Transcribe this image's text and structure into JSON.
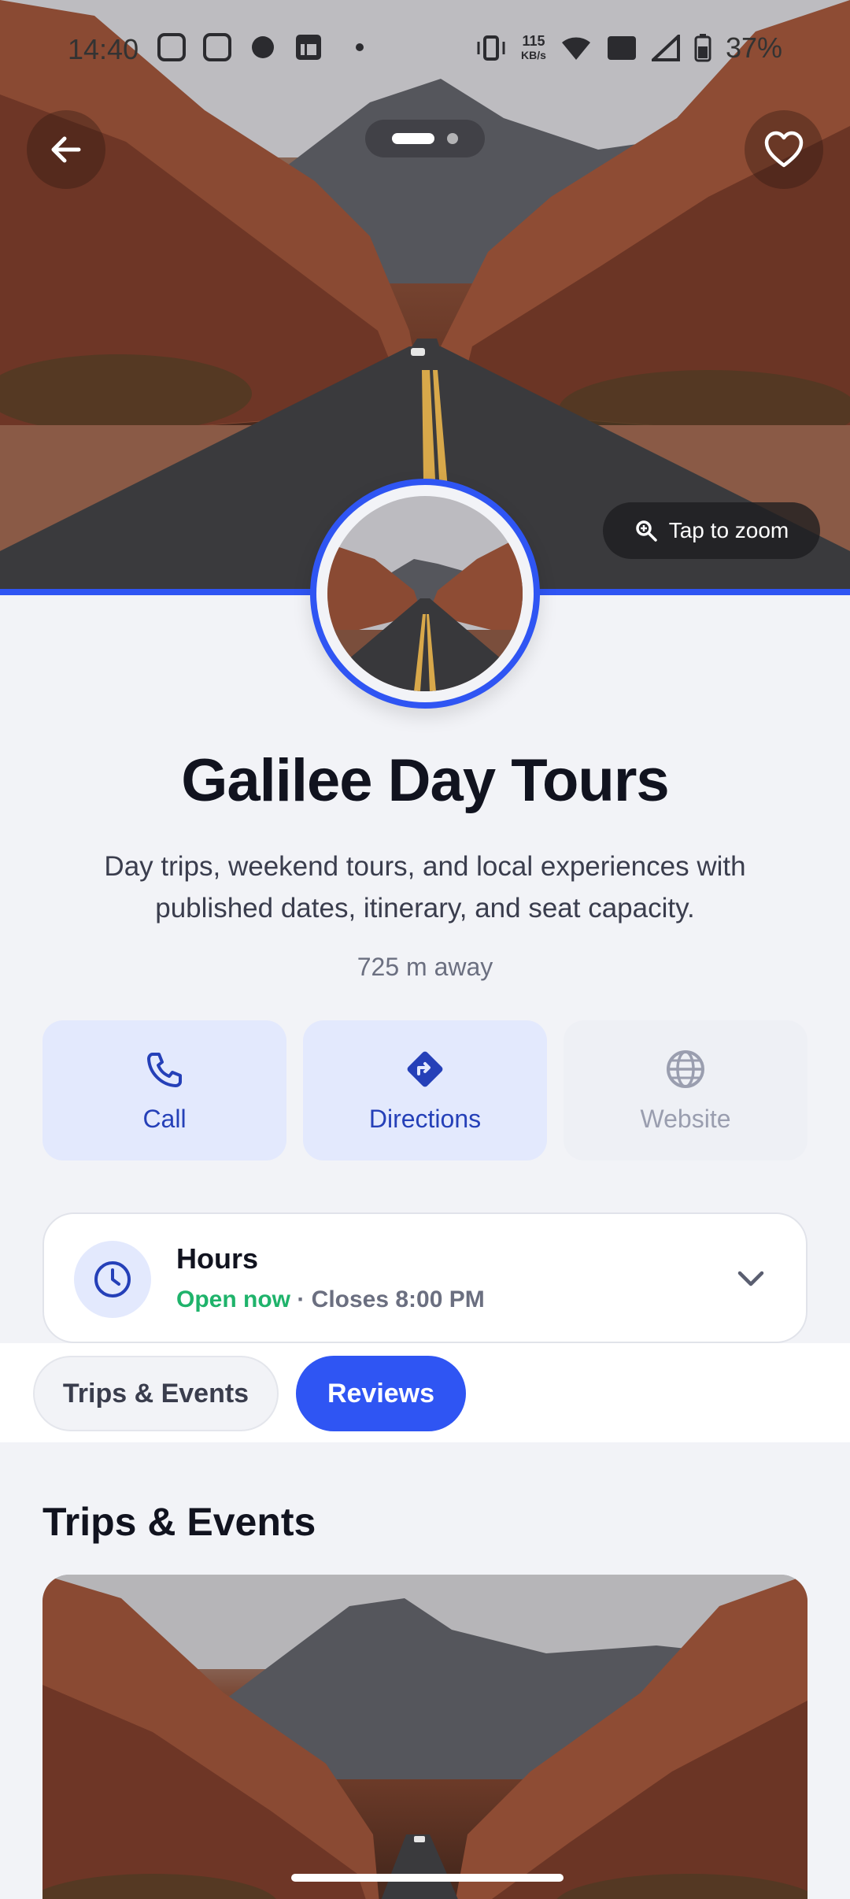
{
  "status_bar": {
    "time": "14:40",
    "net_speed_value": "115",
    "net_speed_unit": "KB/s",
    "battery": "37%"
  },
  "hero": {
    "zoom_label": "Tap to zoom",
    "pager_count": 2,
    "pager_active": 1
  },
  "place": {
    "name": "Galilee Day Tours",
    "description": "Day trips, weekend tours, and local experiences with published dates, itinerary, and seat capacity.",
    "distance": "725 m away"
  },
  "actions": {
    "call": "Call",
    "directions": "Directions",
    "website": "Website"
  },
  "hours": {
    "title": "Hours",
    "open_status": "Open now",
    "closes": " · Closes 8:00 PM"
  },
  "tabs": [
    {
      "label": "Trips & Events",
      "active": false
    },
    {
      "label": "Reviews",
      "active": true
    }
  ],
  "section": {
    "title": "Trips & Events"
  },
  "colors": {
    "accent": "#2f55f3",
    "open_green": "#1fb36b",
    "page_bg": "#f2f3f7"
  }
}
